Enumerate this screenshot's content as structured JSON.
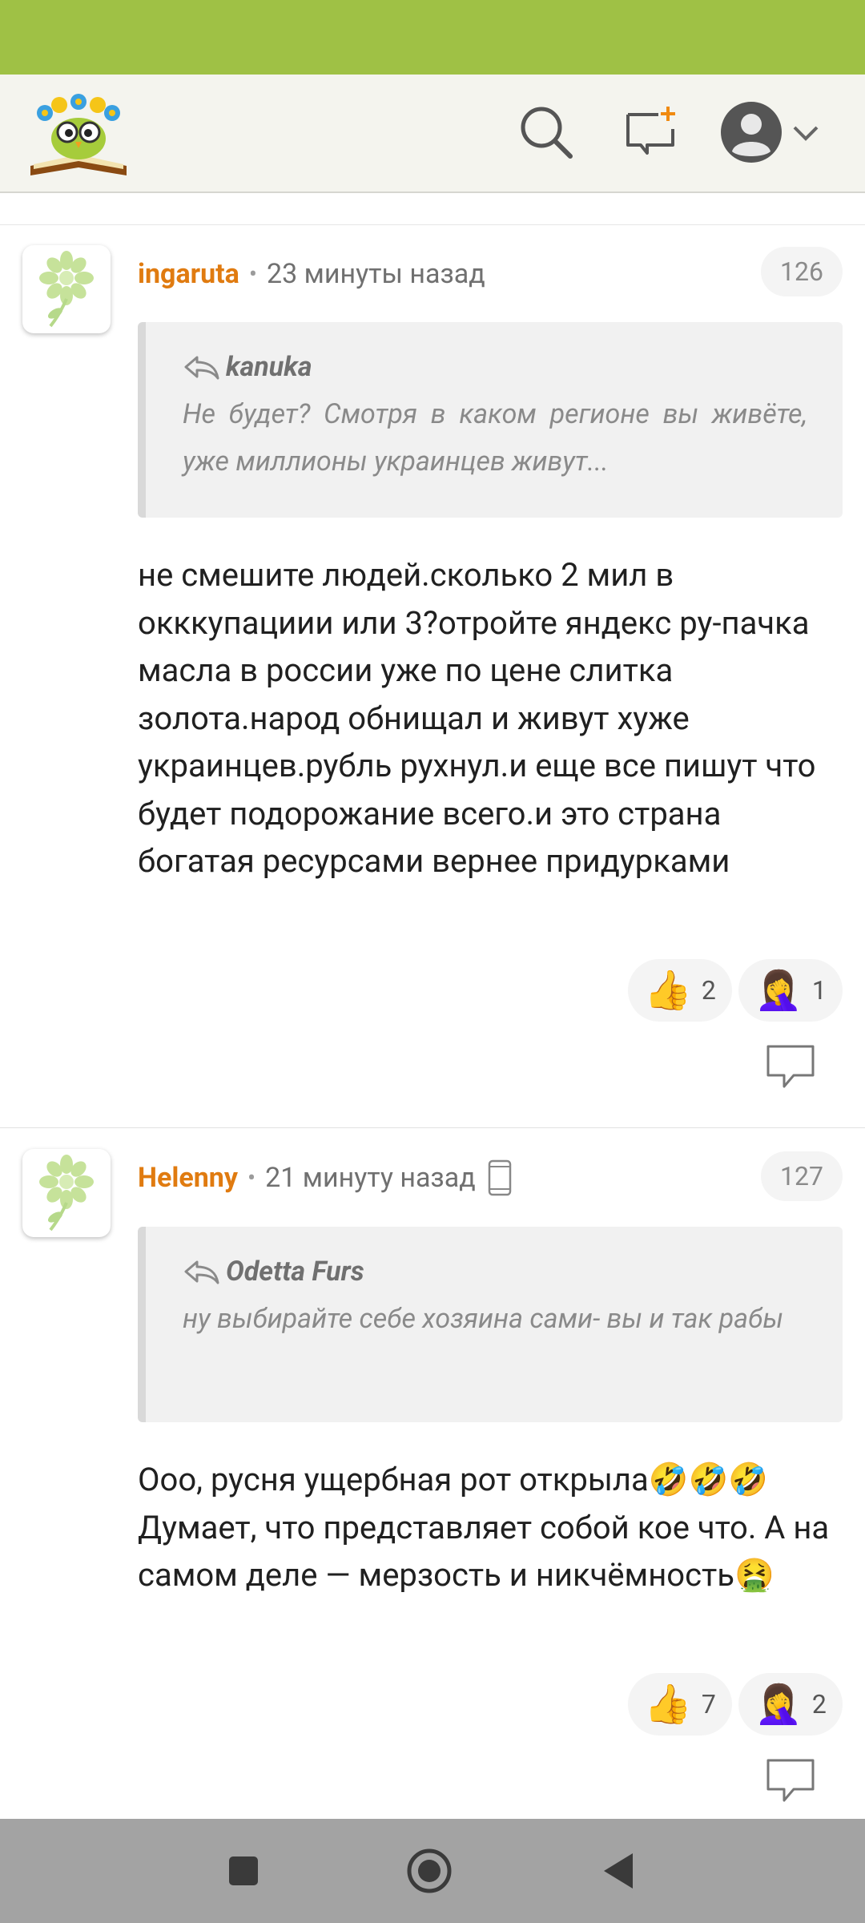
{
  "header": {
    "logo_icon": "owl-on-book-logo",
    "search_icon": "search-icon",
    "new_post_icon": "new-message-icon",
    "profile_icon": "user-avatar-icon",
    "brand_color": "#9fc145"
  },
  "comments": [
    {
      "author": "ingaruta",
      "time": "23 минуты назад",
      "number": "126",
      "quote_author": "kanuka",
      "quote_text": "Не будет? Смотря в каком регионе вы живёте, уже миллионы украинцев живут...",
      "body": "не смешите людей.сколько 2 мил в окккупациии или 3?отройте яндекс ру-пачка масла в россии уже по цене слитка золота.народ обнищал и живут хуже украинцев.рубль рухнул.и еще все пишут что будет подорожание всего.и это страна богатая ресурсами вернее придурками",
      "likes": "2",
      "facepalms": "1"
    },
    {
      "author": "Helenny",
      "time": "21 минуту назад",
      "number": "127",
      "device": "mobile-phone-icon",
      "quote_author": "Odetta Furs",
      "quote_text": "ну выбирайте себе хозяина сами- вы и так рабы",
      "body": "Ооо, русня ущербная рот открыла🤣🤣🤣 Думает, что представляет собой кое что. А на самом деле — мерзость и никчёмность🤮",
      "likes": "7",
      "facepalms": "2"
    }
  ],
  "reactions": {
    "like_emoji": "👍",
    "facepalm_emoji": "🤦‍♀️"
  },
  "author_color": "#e07b10"
}
